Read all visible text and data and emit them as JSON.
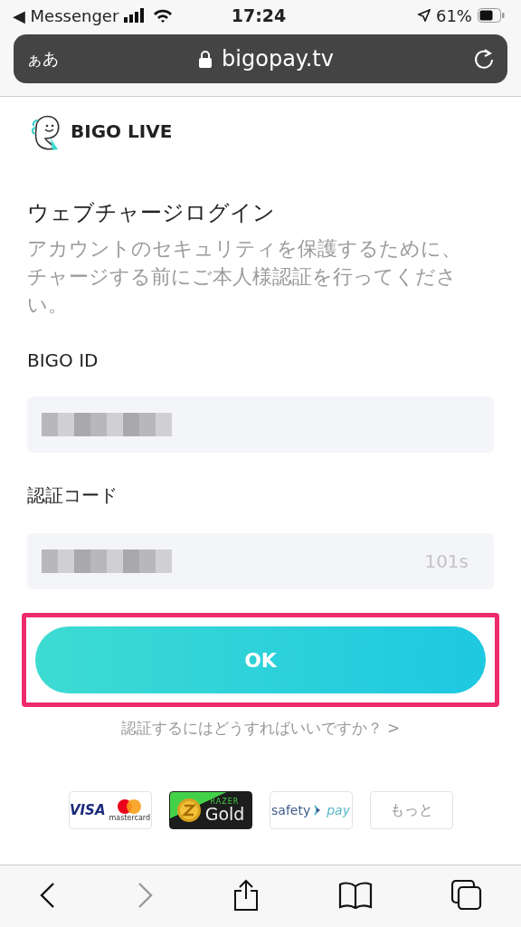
{
  "status_bar": {
    "back_app": "◀ Messenger",
    "time": "17:24",
    "battery": "61%"
  },
  "url_bar": {
    "text_size": "ぁあ",
    "url": "bigopay.tv"
  },
  "brand": {
    "name": "BIGO LIVE"
  },
  "title": "ウェブチャージログイン",
  "description": "アカウントのセキュリティを保護するために、チャージする前にご本人様認証を行ってください。",
  "fields": [
    {
      "label": "BIGO ID",
      "redacted": true
    },
    {
      "label": "認証コード",
      "redacted": true,
      "countdown": "101s"
    }
  ],
  "ok_button": {
    "label": "OK",
    "highlighted": true
  },
  "help_link": "認証するにはどうすればいいですか？ >",
  "payment_methods": [
    {
      "kind": "card",
      "visa": "VISA",
      "mc": "mastercard"
    },
    {
      "kind": "razer",
      "small": "RAZER",
      "big": "Gold"
    },
    {
      "kind": "safety",
      "a": "safety",
      "b": "pay"
    },
    {
      "kind": "more",
      "label": "もっと"
    }
  ]
}
